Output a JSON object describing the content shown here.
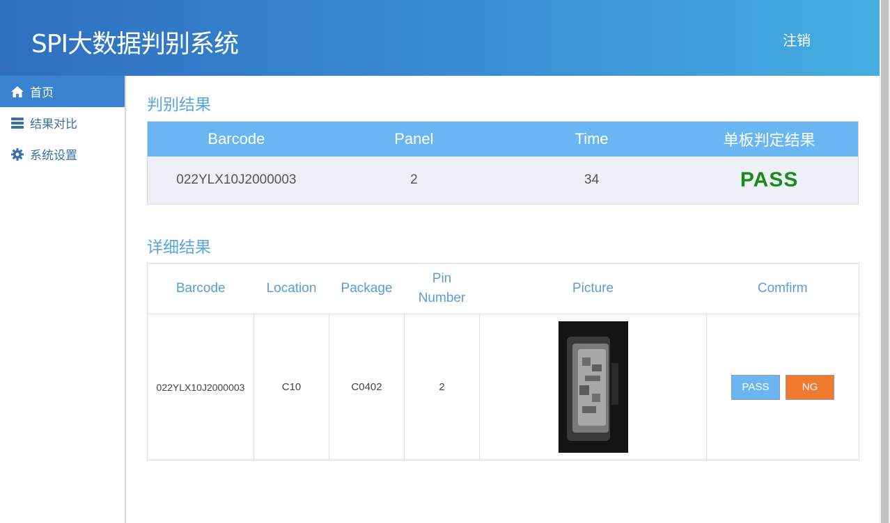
{
  "header": {
    "title": "SPI大数据判别系统",
    "logout_label": "注销"
  },
  "sidebar": {
    "items": [
      {
        "label": "首页",
        "icon": "home-icon",
        "active": true
      },
      {
        "label": "结果对比",
        "icon": "server-icon",
        "active": false
      },
      {
        "label": "系统设置",
        "icon": "gear-icon",
        "active": false
      }
    ]
  },
  "summary": {
    "title": "判别结果",
    "columns": [
      "Barcode",
      "Panel",
      "Time",
      "单板判定结果"
    ],
    "row": {
      "barcode": "022YLX10J2000003",
      "panel": "2",
      "time": "34",
      "result": "PASS"
    },
    "result_color": "#1a8a1a"
  },
  "detail": {
    "title": "详细结果",
    "columns": [
      "Barcode",
      "Location",
      "Package",
      "Pin Number",
      "Picture",
      "Comfirm"
    ],
    "row": {
      "barcode": "022YLX10J2000003",
      "location": "C10",
      "package": "C0402",
      "pin_number": "2",
      "pass_label": "PASS",
      "ng_label": "NG"
    }
  },
  "colors": {
    "accent": "#3a83cf",
    "header_cell": "#69b6f2",
    "ng_button": "#f07a30"
  }
}
